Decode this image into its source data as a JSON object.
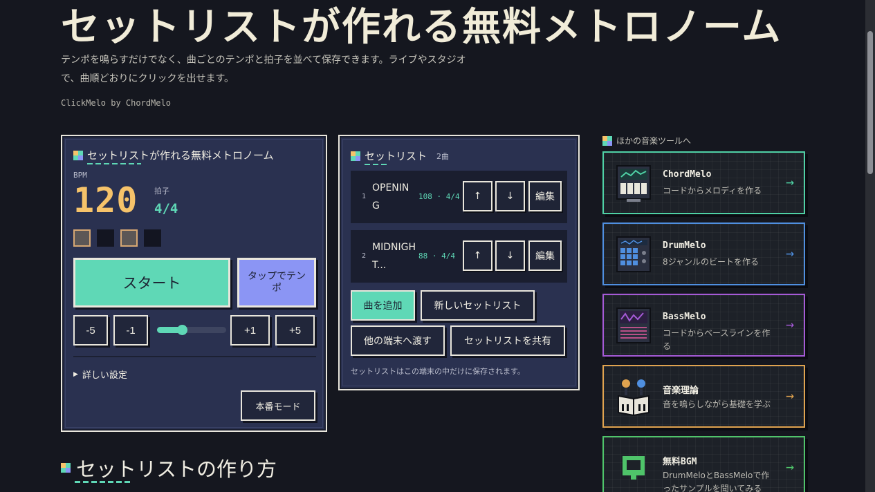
{
  "hero": {
    "title": "セットリストが作れる無料メトロノーム",
    "description": "テンポを鳴らすだけでなく、曲ごとのテンポと拍子を並べて保存できます。ライブやスタジオで、曲順どおりにクリックを出せます。",
    "byline": "ClickMelo by ChordMelo"
  },
  "metronome": {
    "heading": "セットリストが作れる無料メトロノーム",
    "bpm_label": "BPM",
    "bpm": "120",
    "beat_label": "拍子",
    "beat": "4/4",
    "beats": [
      true,
      false,
      true,
      false
    ],
    "start_label": "スタート",
    "tap_label": "タップでテンポ",
    "minus5": "-5",
    "minus1": "-1",
    "plus1": "+1",
    "plus5": "+5",
    "slider_fraction": 0.36,
    "details_label": "詳しい設定",
    "live_mode_label": "本番モード"
  },
  "setlist": {
    "heading": "セットリスト",
    "count": "2曲",
    "songs": [
      {
        "index": "1",
        "name": "OPENING",
        "meta": "108 · 4/4"
      },
      {
        "index": "2",
        "name": "MIDNIGHT...",
        "meta": "88 · 4/4"
      }
    ],
    "up_label": "↑",
    "down_label": "↓",
    "edit_label": "編集",
    "add_song_label": "曲を追加",
    "new_setlist_label": "新しいセットリスト",
    "transfer_label": "他の端末へ渡す",
    "share_label": "セットリストを共有",
    "note": "セットリストはこの端末の中だけに保存されます。"
  },
  "tools": {
    "heading": "ほかの音楽ツールへ",
    "items": [
      {
        "title": "ChordMelo",
        "desc": "コードからメロディを作る",
        "color": "#4fd1a5",
        "arrow": "→"
      },
      {
        "title": "DrumMelo",
        "desc": "8ジャンルのビートを作る",
        "color": "#4f8fe0",
        "arrow": "→"
      },
      {
        "title": "BassMelo",
        "desc": "コードからベースラインを作る",
        "color": "#a55ad6",
        "arrow": "→"
      },
      {
        "title": "音楽理論",
        "desc": "音を鳴らしながら基礎を学ぶ",
        "color": "#e0a34f",
        "arrow": "→"
      },
      {
        "title": "無料BGM",
        "desc": "DrumMeloとBassMeloで作ったサンプルを聞いてみる",
        "color": "#4fc46a",
        "arrow": "→"
      }
    ]
  },
  "howto": {
    "heading": "セットリストの作り方"
  },
  "colors": {
    "accent": "#5fd8b6",
    "bpm": "#f6c36a",
    "tap": "#8b95f4",
    "panel": "#2a3150",
    "background": "#15171f"
  }
}
